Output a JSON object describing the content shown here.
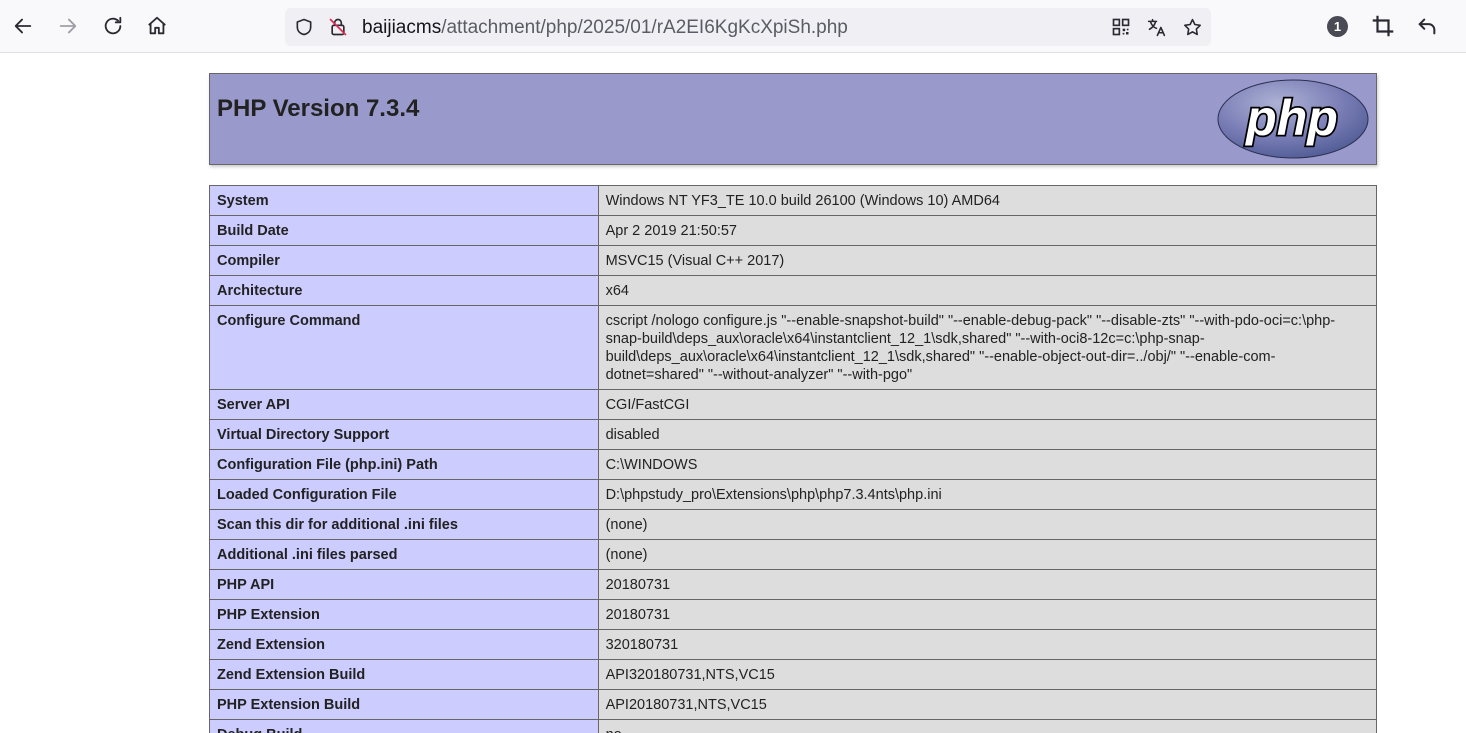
{
  "browser": {
    "url_host": "baijiacms",
    "url_path": "/attachment/php/2025/01/rA2EI6KgKcXpiSh.php",
    "extensions_badge": "1",
    "icons": {
      "back": "back-arrow-icon",
      "forward": "forward-arrow-icon",
      "reload": "reload-icon",
      "home": "home-icon",
      "shield": "tracking-shield-icon",
      "lock": "insecure-lock-icon",
      "qr": "qr-code-icon",
      "translate": "translate-icon",
      "bookmark": "bookmark-star-icon",
      "crop": "screenshot-crop-icon",
      "undo": "undo-arrow-icon"
    }
  },
  "phpinfo": {
    "title": "PHP Version 7.3.4",
    "logo_text": "php",
    "colors": {
      "header": "#9999cc",
      "key_cell": "#ccccff",
      "value_cell": "#dddddd",
      "border": "#666666"
    },
    "rows": [
      {
        "key": "System",
        "value": "Windows NT YF3_TE 10.0 build 26100 (Windows 10) AMD64"
      },
      {
        "key": "Build Date",
        "value": "Apr 2 2019 21:50:57"
      },
      {
        "key": "Compiler",
        "value": "MSVC15 (Visual C++ 2017)"
      },
      {
        "key": "Architecture",
        "value": "x64"
      },
      {
        "key": "Configure Command",
        "value": "cscript /nologo configure.js \"--enable-snapshot-build\" \"--enable-debug-pack\" \"--disable-zts\" \"--with-pdo-oci=c:\\php-snap-build\\deps_aux\\oracle\\x64\\instantclient_12_1\\sdk,shared\" \"--with-oci8-12c=c:\\php-snap-build\\deps_aux\\oracle\\x64\\instantclient_12_1\\sdk,shared\" \"--enable-object-out-dir=../obj/\" \"--enable-com-dotnet=shared\" \"--without-analyzer\" \"--with-pgo\""
      },
      {
        "key": "Server API",
        "value": "CGI/FastCGI"
      },
      {
        "key": "Virtual Directory Support",
        "value": "disabled"
      },
      {
        "key": "Configuration File (php.ini) Path",
        "value": "C:\\WINDOWS"
      },
      {
        "key": "Loaded Configuration File",
        "value": "D:\\phpstudy_pro\\Extensions\\php\\php7.3.4nts\\php.ini"
      },
      {
        "key": "Scan this dir for additional .ini files",
        "value": "(none)"
      },
      {
        "key": "Additional .ini files parsed",
        "value": "(none)"
      },
      {
        "key": "PHP API",
        "value": "20180731"
      },
      {
        "key": "PHP Extension",
        "value": "20180731"
      },
      {
        "key": "Zend Extension",
        "value": "320180731"
      },
      {
        "key": "Zend Extension Build",
        "value": "API320180731,NTS,VC15"
      },
      {
        "key": "PHP Extension Build",
        "value": "API20180731,NTS,VC15"
      },
      {
        "key": "Debug Build",
        "value": "no"
      }
    ]
  }
}
